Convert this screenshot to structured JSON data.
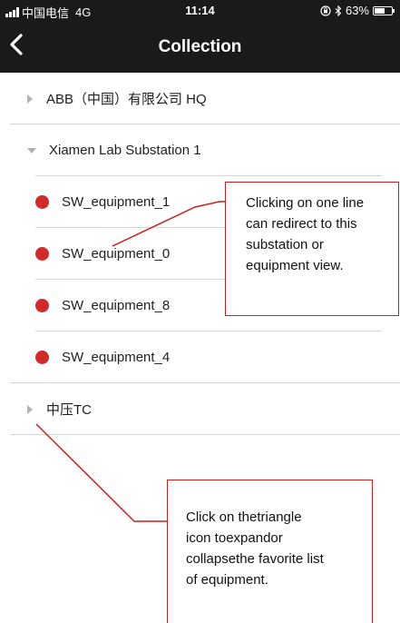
{
  "status_bar": {
    "carrier": "中国电信",
    "network": "4G",
    "time": "11:14",
    "battery_percent_label": "63%",
    "battery_level": 0.63
  },
  "nav": {
    "title": "Collection",
    "back_icon": "chevron-left-icon"
  },
  "list": {
    "groups": [
      {
        "label": "ABB（中国）有限公司 HQ",
        "expanded": false
      },
      {
        "label": "Xiamen Lab Substation 1",
        "expanded": true,
        "items": [
          {
            "label": "SW_equipment_1"
          },
          {
            "label": "SW_equipment_0"
          },
          {
            "label": "SW_equipment_8"
          },
          {
            "label": "SW_equipment_4"
          }
        ]
      },
      {
        "label": "中压TC",
        "expanded": false
      }
    ]
  },
  "annotations": {
    "line_click": "Clicking on one line\ncan redirect to this\nsubstation or\nequipment view.",
    "triangle_click": "Click on thetriangle\nicon toexpandor\ncollapsethe favorite list\nof equipment."
  },
  "colors": {
    "header_bg": "#1a1a1a",
    "status_dot": "#d12a2a",
    "annotation_border": "#cc1f1f",
    "separator": "#d5d5d5"
  }
}
